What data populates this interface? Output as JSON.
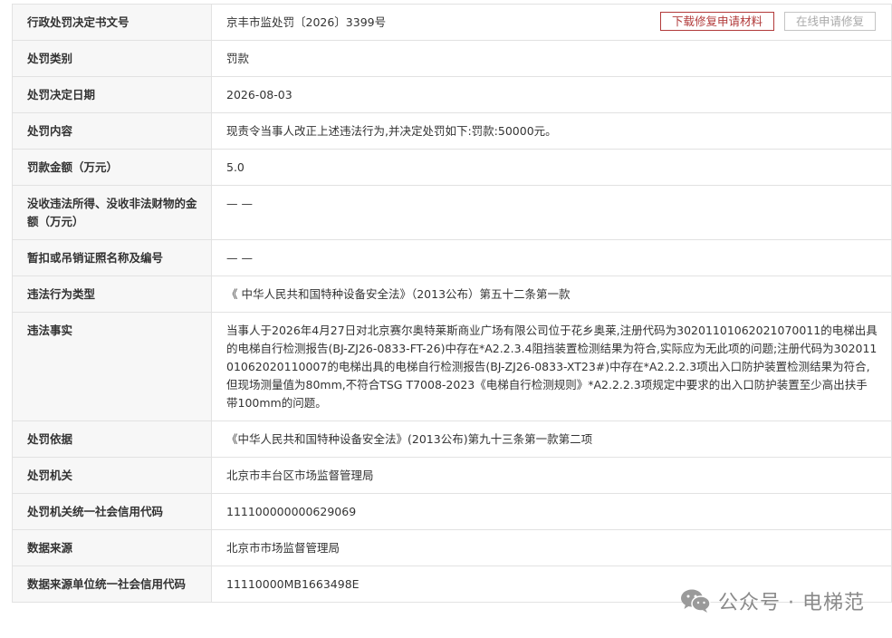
{
  "actions": {
    "download_label": "下载修复申请材料",
    "online_label": "在线申请修复"
  },
  "rows": [
    {
      "label": "行政处罚决定书文号",
      "value": "京丰市监处罚〔2026〕3399号"
    },
    {
      "label": "处罚类别",
      "value": "罚款"
    },
    {
      "label": "处罚决定日期",
      "value": "2026-08-03"
    },
    {
      "label": "处罚内容",
      "value": "现责令当事人改正上述违法行为,并决定处罚如下:罚款:50000元。"
    },
    {
      "label": "罚款金额（万元）",
      "value": "5.0"
    },
    {
      "label": "没收违法所得、没收非法财物的金额（万元）",
      "value": "— —"
    },
    {
      "label": "暂扣或吊销证照名称及编号",
      "value": "— —"
    },
    {
      "label": "违法行为类型",
      "value": "《 中华人民共和国特种设备安全法》（2013公布）第五十二条第一款"
    },
    {
      "label": "违法事实",
      "value": "当事人于2026年4月27日对北京赛尔奥特莱斯商业广场有限公司位于花乡奥莱,注册代码为30201101062021070011的电梯出具的电梯自行检测报告(BJ-ZJ26-0833-FT-26)中存在*A2.2.3.4阻挡装置检测结果为符合,实际应为无此项的问题;注册代码为30201101062020110007的电梯出具的电梯自行检测报告(BJ-ZJ26-0833-XT23#)中存在*A2.2.2.3项出入口防护装置检测结果为符合,但现场测量值为80mm,不符合TSG T7008-2023《电梯自行检测规则》*A2.2.2.3项规定中要求的出入口防护装置至少高出扶手带100mm的问题。"
    },
    {
      "label": "处罚依据",
      "value": "《中华人民共和国特种设备安全法》(2013公布)第九十三条第一款第二项"
    },
    {
      "label": "处罚机关",
      "value": "北京市丰台区市场监督管理局"
    },
    {
      "label": "处罚机关统一社会信用代码",
      "value": "111100000000629069"
    },
    {
      "label": "数据来源",
      "value": "北京市市场监督管理局"
    },
    {
      "label": "数据来源单位统一社会信用代码",
      "value": "11110000MB1663498E"
    }
  ],
  "watermark": {
    "text": "公众号 · 电梯范",
    "icon": "wechat-icon"
  }
}
